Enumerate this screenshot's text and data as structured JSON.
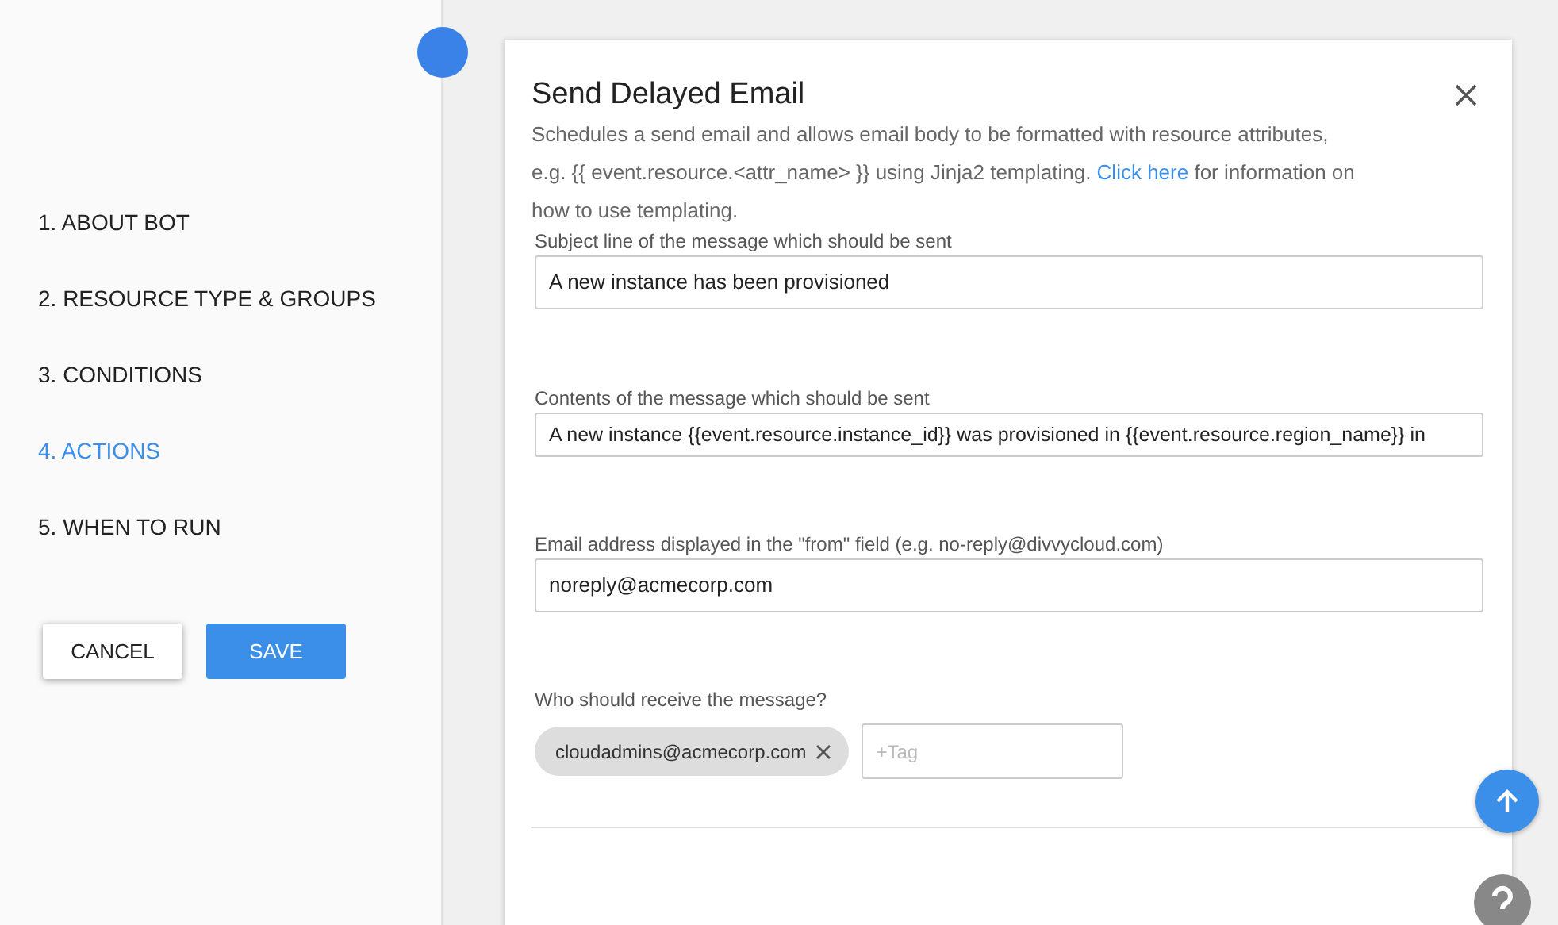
{
  "steps": [
    {
      "label": "1. ABOUT BOT",
      "selected": false
    },
    {
      "label": "2. RESOURCE TYPE & GROUPS",
      "selected": false
    },
    {
      "label": "3. CONDITIONS",
      "selected": false
    },
    {
      "label": "4. ACTIONS",
      "selected": true
    },
    {
      "label": "5. WHEN TO RUN",
      "selected": false
    }
  ],
  "buttons": [
    {
      "label": "CANCEL",
      "kind": "secondary"
    },
    {
      "label": "SAVE",
      "kind": "primary"
    }
  ],
  "card": {
    "title": "Send Delayed Email",
    "description": "Schedules a send email and allows email body to be formatted with resource attributes, e.g. {{ event.resource.<attr_name> }} using Jinja2 templating.",
    "link": "Click here",
    "description_end": "for information on how to use templating.",
    "fields": [
      {
        "kind": "input",
        "label": "Subject line of the message which should be sent",
        "value": "A new instance has been provisioned"
      },
      {
        "kind": "textarea",
        "label": "Contents of the message which should be sent",
        "value": "A new instance {{event.resource.instance_id}} was provisioned in {{event.resource.region_name}} in"
      },
      {
        "kind": "input",
        "label": "Email address displayed in the \"from\" field (e.g. no-reply@divvycloud.com)",
        "value": "noreply@acmecorp.com"
      },
      {
        "kind": "tags",
        "label": "Who should receive the message?",
        "tags": [
          "cloudadmins@acmecorp.com"
        ],
        "placeholder": "+Tag"
      }
    ]
  }
}
